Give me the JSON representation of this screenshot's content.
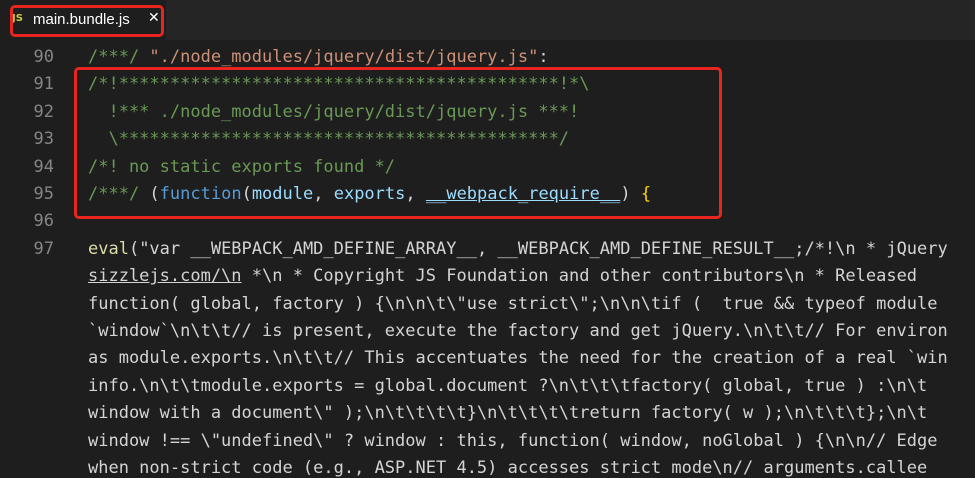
{
  "tab": {
    "icon": "JS",
    "label": "main.bundle.js",
    "close": "✕"
  },
  "lines": [
    {
      "num": "90",
      "parts": [
        {
          "text": "/***/ ",
          "cls": "c"
        },
        {
          "text": "\"./node_modules/jquery/dist/jquery.js\"",
          "cls": "s"
        },
        {
          "text": ":",
          "cls": ""
        }
      ]
    },
    {
      "num": "91",
      "parts": [
        {
          "text": "/*!*******************************************!*\\",
          "cls": "c"
        }
      ]
    },
    {
      "num": "92",
      "parts": [
        {
          "text": "  !*** ./node_modules/jquery/dist/jquery.js ***!",
          "cls": "c"
        }
      ]
    },
    {
      "num": "93",
      "parts": [
        {
          "text": "  \\*******************************************/",
          "cls": "c"
        }
      ]
    },
    {
      "num": "94",
      "parts": [
        {
          "text": "/*! no static exports found */",
          "cls": "c"
        }
      ]
    },
    {
      "num": "95",
      "parts": [
        {
          "text": "/***/ ",
          "cls": "c"
        },
        {
          "text": "(",
          "cls": ""
        },
        {
          "text": "function",
          "cls": "k"
        },
        {
          "text": "(",
          "cls": ""
        },
        {
          "text": "module",
          "cls": "v"
        },
        {
          "text": ", ",
          "cls": ""
        },
        {
          "text": "exports",
          "cls": "v"
        },
        {
          "text": ", ",
          "cls": ""
        },
        {
          "text": "__webpack_require__",
          "cls": "v u"
        },
        {
          "text": ") ",
          "cls": ""
        },
        {
          "text": "{",
          "cls": "b"
        }
      ]
    },
    {
      "num": "96",
      "parts": []
    },
    {
      "num": "97",
      "parts": [
        {
          "text": "eval",
          "cls": "f"
        },
        {
          "text": "(\"var __WEBPACK_AMD_DEFINE_ARRAY__, __WEBPACK_AMD_DEFINE_RESULT__;/*!\\n * jQuery",
          "cls": ""
        }
      ]
    },
    {
      "num": "",
      "parts": [
        {
          "text": "sizzlejs.com/\\n",
          "cls": "u"
        },
        {
          "text": " *\\n * Copyright JS Foundation and other contributors\\n * Released",
          "cls": ""
        }
      ]
    },
    {
      "num": "",
      "parts": [
        {
          "text": "function( global, factory ) {\\n\\n\\t\\\"use strict\\\";\\n\\n\\tif (  true && typeof module",
          "cls": ""
        }
      ]
    },
    {
      "num": "",
      "parts": [
        {
          "text": "`window`\\n\\t\\t// is present, execute the factory and get jQuery.\\n\\t\\t// For environ",
          "cls": ""
        }
      ]
    },
    {
      "num": "",
      "parts": [
        {
          "text": "as module.exports.\\n\\t\\t// This accentuates the need for the creation of a real `win",
          "cls": ""
        }
      ]
    },
    {
      "num": "",
      "parts": [
        {
          "text": "info.\\n\\t\\tmodule.exports = global.document ?\\n\\t\\t\\tfactory( global, true ) :\\n\\t",
          "cls": ""
        }
      ]
    },
    {
      "num": "",
      "parts": [
        {
          "text": "window with a document\\\" );\\n\\t\\t\\t\\t}\\n\\t\\t\\t\\treturn factory( w );\\n\\t\\t\\t};\\n\\t",
          "cls": ""
        }
      ]
    },
    {
      "num": "",
      "parts": [
        {
          "text": "window !== \\\"undefined\\\" ? window : this, function( window, noGlobal ) {\\n\\n// Edge",
          "cls": ""
        }
      ]
    },
    {
      "num": "",
      "parts": [
        {
          "text": "when non-strict code (e.g., ASP.NET 4.5) accesses strict mode\\n// arguments.callee",
          "cls": ""
        }
      ]
    }
  ]
}
